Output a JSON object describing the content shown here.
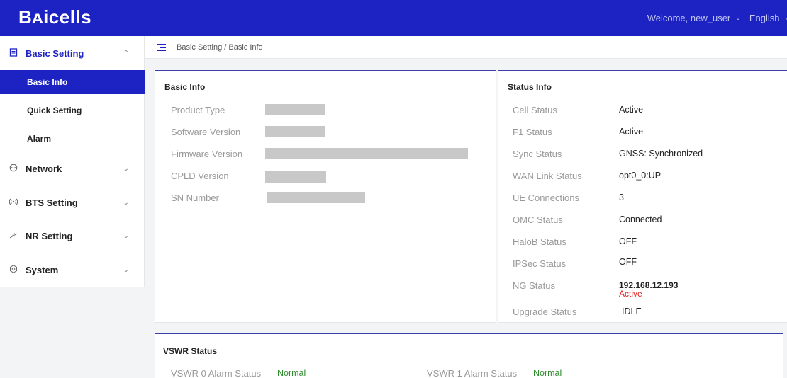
{
  "header": {
    "logo": "Bᴀicells",
    "welcome": "Welcome, new_user",
    "language": "English"
  },
  "sidebar": {
    "groups": [
      {
        "label": "Basic Setting",
        "icon": "document-icon"
      },
      {
        "label": "Network",
        "icon": "globe-icon"
      },
      {
        "label": "BTS Setting",
        "icon": "antenna-icon"
      },
      {
        "label": "NR Setting",
        "icon": "signal-icon"
      },
      {
        "label": "System",
        "icon": "settings-icon"
      }
    ],
    "sub_items": [
      "Basic Info",
      "Quick Setting",
      "Alarm"
    ]
  },
  "breadcrumb": "Basic Setting / Basic Info",
  "basic_info": {
    "title": "Basic Info",
    "labels": [
      "Product Type",
      "Software Version",
      "Firmware Version",
      "CPLD Version",
      "SN Number"
    ]
  },
  "status_info": {
    "title": "Status Info",
    "rows": [
      {
        "label": "Cell Status",
        "value": "Active"
      },
      {
        "label": "F1 Status",
        "value": "Active"
      },
      {
        "label": "Sync Status",
        "value": "GNSS: Synchronized"
      },
      {
        "label": "WAN Link Status",
        "value": "opt0_0:UP"
      },
      {
        "label": "UE Connections",
        "value": "3"
      },
      {
        "label": "OMC Status",
        "value": "Connected"
      },
      {
        "label": "HaloB Status",
        "value": "OFF"
      },
      {
        "label": "IPSec Status",
        "value": "OFF"
      },
      {
        "label": "NG Status",
        "value": "192.168.12.193",
        "value2": "Active"
      },
      {
        "label": "Upgrade Status",
        "value": "IDLE"
      }
    ]
  },
  "vswr": {
    "title": "VSWR Status",
    "items": [
      {
        "label": "VSWR 0 Alarm Status",
        "value": "Normal"
      },
      {
        "label": "VSWR 1 Alarm Status",
        "value": "Normal"
      }
    ]
  },
  "colors": {
    "brand": "#1c23c2",
    "alert": "#e02020",
    "ok": "#2e8b2e"
  }
}
